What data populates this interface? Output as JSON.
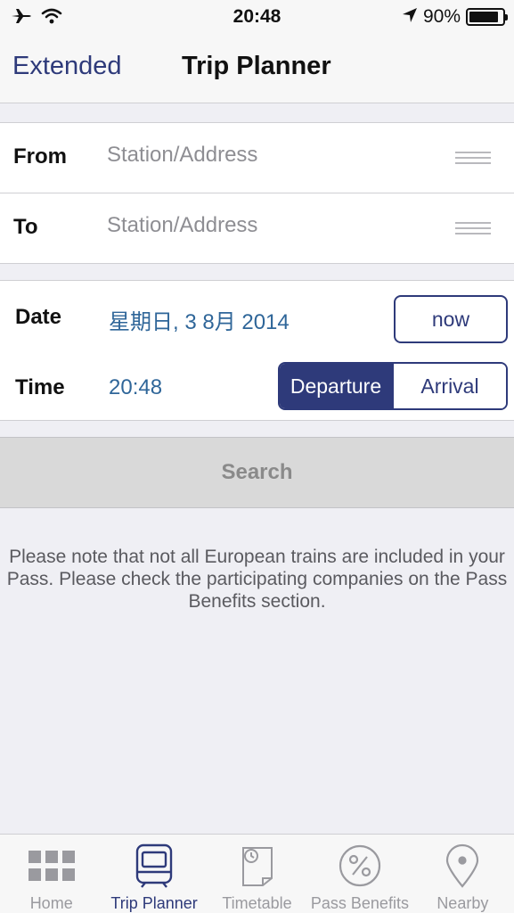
{
  "status_bar": {
    "time": "20:48",
    "battery_percent": "90%",
    "battery_level": 0.9,
    "icons": [
      "airplane-icon",
      "wifi-icon",
      "location-arrow-icon",
      "battery-icon"
    ]
  },
  "nav": {
    "back_label": "Extended",
    "title": "Trip Planner"
  },
  "route": {
    "from_label": "From",
    "from_placeholder": "Station/Address",
    "from_value": "",
    "to_label": "To",
    "to_placeholder": "Station/Address",
    "to_value": ""
  },
  "datetime": {
    "date_label": "Date",
    "date_value": "星期日, 3 8月 2014",
    "now_button": "now",
    "time_label": "Time",
    "time_value": "20:48",
    "mode_options": [
      "Departure",
      "Arrival"
    ],
    "selected_mode": "Departure"
  },
  "search_button": "Search",
  "note": "Please note that not all European trains are included in your Pass. Please check the participating companies on the Pass Benefits section.",
  "tabs": [
    {
      "label": "Home",
      "icon": "grid-icon",
      "active": false
    },
    {
      "label": "Trip Planner",
      "icon": "train-icon",
      "active": true
    },
    {
      "label": "Timetable",
      "icon": "timetable-icon",
      "active": false
    },
    {
      "label": "Pass Benefits",
      "icon": "percent-icon",
      "active": false
    },
    {
      "label": "Nearby",
      "icon": "map-pin-icon",
      "active": false
    }
  ],
  "colors": {
    "accent": "#2e3a7a",
    "value_blue": "#2f6699",
    "background": "#efeff4"
  }
}
